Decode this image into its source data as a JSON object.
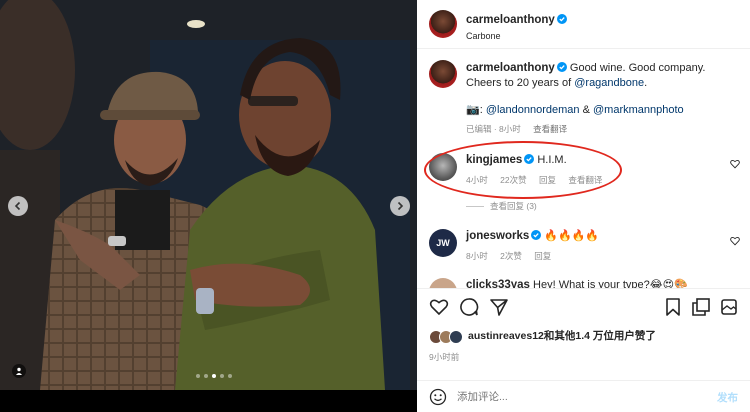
{
  "post": {
    "author": "carmeloanthony",
    "location": "Carbone"
  },
  "caption": {
    "author": "carmeloanthony",
    "line1": "Good wine. Good company.",
    "line2_prefix": "Cheers to 20 years of ",
    "line2_mention": "@ragandbone",
    "line2_suffix": ".",
    "credit_prefix": "📷: ",
    "credit_mention1": "@landonnordeman",
    "credit_and": " & ",
    "credit_mention2": "@markmannphoto",
    "edited": "已编辑 · 8小时",
    "translate": "查看翻译"
  },
  "comments": [
    {
      "author": "kingjames",
      "text": "H.I.M.",
      "time": "4小时",
      "likes": "22次赞",
      "reply": "回复",
      "translate": "查看翻译",
      "view_replies": "查看回复 (3)"
    },
    {
      "author": "jonesworks",
      "avatar_text": "JW",
      "text": "🔥🔥🔥🔥",
      "time": "8小时",
      "likes": "2次赞",
      "reply": "回复"
    },
    {
      "author": "clicks33yas",
      "text": "Hey! What is your type?😂😍🎨"
    }
  ],
  "likes": {
    "user": "austinreaves12",
    "suffix": "和其他1.4 万位用户赞了"
  },
  "post_time": "9小时前",
  "comment_box": {
    "placeholder": "添加评论...",
    "post_label": "发布"
  },
  "carousel": {
    "slide_count": 5,
    "active_slide": 3
  },
  "colors": {
    "verified": "#0095f6",
    "mention": "#00376b",
    "post_button": "#b2dffc",
    "annotation_circle": "#e0281e"
  }
}
